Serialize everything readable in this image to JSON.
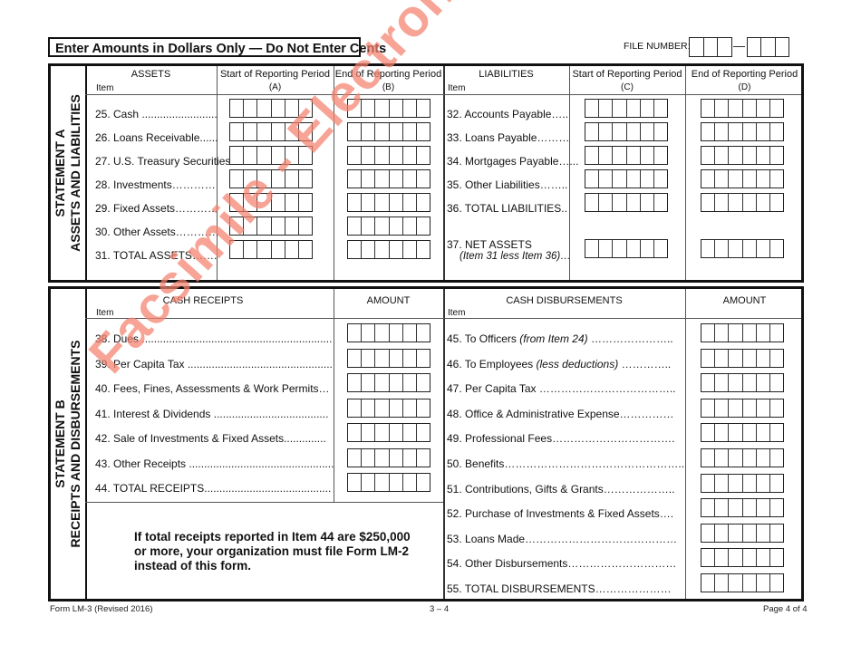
{
  "header": {
    "notice": "Enter Amounts in Dollars Only — Do Not Enter Cents",
    "file_number_label": "FILE NUMBER:",
    "file_number_dash": "—",
    "file_number_value": ""
  },
  "statement_a": {
    "title_line1": "STATEMENT A",
    "title_line2": "ASSETS AND LIABILITIES",
    "assets_header": "ASSETS",
    "item_label": "Item",
    "col_a_header": "Start of Reporting Period",
    "col_a_code": "(A)",
    "col_b_header": "End of Reporting Period",
    "col_b_code": "(B)",
    "liabilities_header": "LIABILITIES",
    "col_c_header": "Start of Reporting Period",
    "col_c_code": "(C)",
    "col_d_header": "End of Reporting Period",
    "col_d_code": "(D)",
    "assets": [
      {
        "label": "25. Cash .........................",
        "start": "",
        "end": ""
      },
      {
        "label": "26. Loans Receivable......",
        "start": "",
        "end": ""
      },
      {
        "label": "27. U.S. Treasury Securities",
        "start": "",
        "end": ""
      },
      {
        "label": "28. Investments…………",
        "start": "",
        "end": ""
      },
      {
        "label": "29. Fixed Assets…………",
        "start": "",
        "end": ""
      },
      {
        "label": "30. Other Assets…………",
        "start": "",
        "end": ""
      },
      {
        "label": "31. TOTAL ASSETS…….",
        "start": "",
        "end": ""
      }
    ],
    "liabilities": [
      {
        "label": "32. Accounts Payable…..",
        "start": "",
        "end": ""
      },
      {
        "label": "33. Loans Payable………",
        "start": "",
        "end": ""
      },
      {
        "label": "34.  Mortgages Payable…...",
        "start": "",
        "end": ""
      },
      {
        "label": "35. Other Liabilities……..",
        "start": "",
        "end": ""
      },
      {
        "label": "36. TOTAL LIABILITIES..",
        "start": "",
        "end": ""
      },
      {
        "label": "37. NET ASSETS",
        "sublabel": "(Item 31 less Item 36)…",
        "start": "",
        "end": ""
      }
    ]
  },
  "statement_b": {
    "title_line1": "STATEMENT B",
    "title_line2": "RECEIPTS AND DISBURSEMENTS",
    "receipts_header": "CASH RECEIPTS",
    "item_label": "Item",
    "amount_header": "AMOUNT",
    "disbursements_header": "CASH DISBURSEMENTS",
    "receipts": [
      {
        "label": "38. Dues ...............................................................",
        "amount": ""
      },
      {
        "label": "39. Per Capita Tax ................................................",
        "amount": ""
      },
      {
        "label": "40. Fees, Fines, Assessments & Work Permits…",
        "amount": ""
      },
      {
        "label": "41. Interest & Dividends ......................................",
        "amount": ""
      },
      {
        "label": "42. Sale of Investments & Fixed Assets..............",
        "amount": ""
      },
      {
        "label": "43. Other Receipts ................................................",
        "amount": ""
      },
      {
        "label": "44. TOTAL RECEIPTS..........................................",
        "amount": ""
      }
    ],
    "disbursements": [
      {
        "label": "45. To Officers",
        "italic": "(from Item 24)",
        "dots": " …………………..",
        "amount": ""
      },
      {
        "label": "46. To Employees",
        "italic": "(less deductions)",
        "dots": " …………..",
        "amount": ""
      },
      {
        "label": "47. Per Capita Tax ………………………………..",
        "italic": "",
        "dots": "",
        "amount": ""
      },
      {
        "label": "48. Office & Administrative Expense……………",
        "italic": "",
        "dots": "",
        "amount": ""
      },
      {
        "label": "49. Professional Fees…………………………….",
        "italic": "",
        "dots": "",
        "amount": ""
      },
      {
        "label": "50. Benefits…………………………………………..",
        "italic": "",
        "dots": "",
        "amount": ""
      },
      {
        "label": "51. Contributions, Gifts & Grants………………..",
        "italic": "",
        "dots": "",
        "amount": ""
      },
      {
        "label": "52. Purchase of Investments & Fixed Assets….",
        "italic": "",
        "dots": "",
        "amount": ""
      },
      {
        "label": "53. Loans Made……………………………………",
        "italic": "",
        "dots": "",
        "amount": ""
      },
      {
        "label": "54. Other Disbursements…………………………",
        "italic": "",
        "dots": "",
        "amount": ""
      },
      {
        "label": "55. TOTAL DISBURSEMENTS…………………",
        "italic": "",
        "dots": "",
        "amount": ""
      }
    ],
    "lm2_notice": "If total receipts reported in Item 44 are $250,000 or more, your organization must file Form LM-2 instead of this form."
  },
  "footer": {
    "form_id": "Form LM-3 (Revised 2016)",
    "page_range": "3 – 4",
    "page": "Page 4 of 4"
  },
  "watermark": {
    "text": "Facsimile - Electronic Filing Required",
    "color": "#f4826e"
  }
}
